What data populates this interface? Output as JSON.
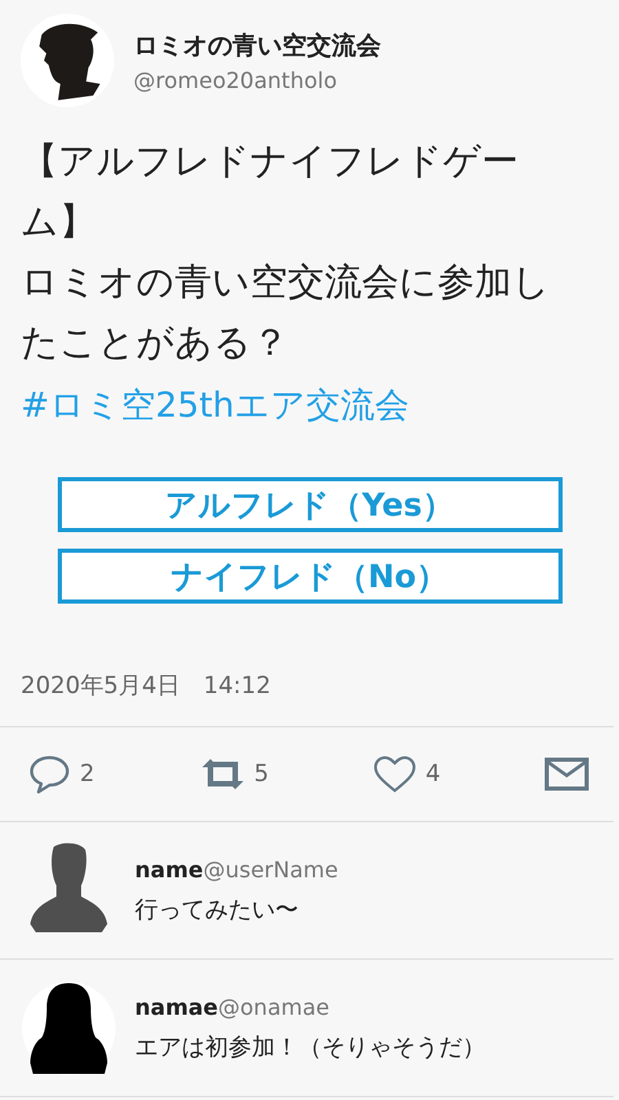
{
  "account": {
    "name": "ロミオの青い空交流会",
    "handle": "@romeo20antholo"
  },
  "post": {
    "title": "【アルフレドナイフレドゲーム】",
    "question": "ロミオの青い空交流会に参加したことがある？",
    "hashtag": "#ロミ空25thエア交流会"
  },
  "choices": [
    "アルフレド（Yes）",
    "ナイフレド（No）"
  ],
  "timestamp": "2020年5月4日　14:12",
  "actions": [
    {
      "kind": "reply",
      "count": "2"
    },
    {
      "kind": "retweet",
      "count": "5"
    },
    {
      "kind": "like",
      "count": "4"
    },
    {
      "kind": "message"
    }
  ],
  "replies": [
    {
      "kind": "man",
      "name": "name",
      "handle": "@userName",
      "text": "行ってみたい〜"
    },
    {
      "kind": "woman",
      "name": "namae",
      "handle": "@onamae",
      "text": "エアは初参加！（そりゃそうだ）"
    }
  ]
}
